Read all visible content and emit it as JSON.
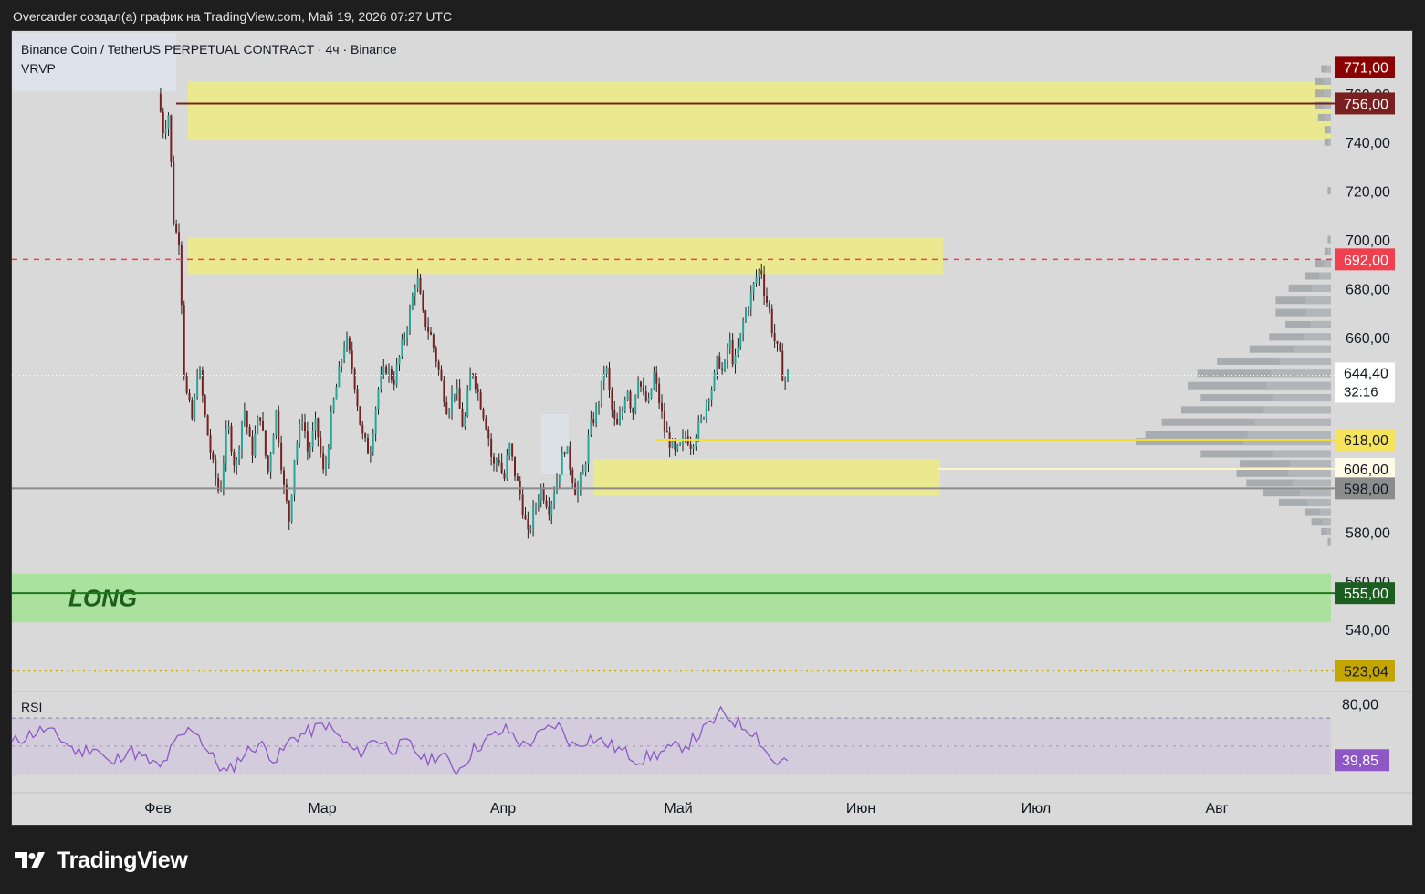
{
  "caption": "Overcarder создал(а) график на TradingView.com, Май 19, 2026 07:27 UTC",
  "brand": {
    "name": "TradingView",
    "logo_icon": "tradingview-logo-icon"
  },
  "legend": {
    "symbol_line": "Binance Coin / TetherUS PERPETUAL CONTRACT · 4ч · Binance",
    "indicator": "VRVP"
  },
  "colors": {
    "page_bg": "#1e1e1e",
    "chart_bg": "#d9d9d9",
    "candle_up": "#26a69a",
    "candle_down": "#7a1f1f",
    "resistance_zone": "#ecea8c",
    "long_zone": "#a8e29a",
    "long_text": "#1b5e20",
    "red_dashed": "#f0404f",
    "rsi_line": "#8f57c6",
    "rsi_band": "#cfc8dc",
    "volume_profile": "#9fa3a8"
  },
  "chart_data": {
    "type": "candlestick",
    "symbol": "Binance Coin / TetherUS PERPETUAL CONTRACT",
    "timeframe": "4ч",
    "exchange": "Binance",
    "x_ticks": [
      "Фев",
      "Мар",
      "Апр",
      "Май",
      "Июн",
      "Июл",
      "Авг"
    ],
    "y_ticks": [
      540,
      560,
      580,
      600,
      620,
      640,
      660,
      680,
      700,
      720,
      740,
      760
    ],
    "ylim": [
      515,
      785
    ],
    "scale": "linear",
    "grid": false,
    "price_path": [
      [
        0.0,
        760
      ],
      [
        0.004,
        745
      ],
      [
        0.008,
        752
      ],
      [
        0.012,
        705
      ],
      [
        0.016,
        700
      ],
      [
        0.02,
        640
      ],
      [
        0.026,
        625
      ],
      [
        0.03,
        650
      ],
      [
        0.035,
        628
      ],
      [
        0.04,
        610
      ],
      [
        0.046,
        595
      ],
      [
        0.052,
        625
      ],
      [
        0.058,
        605
      ],
      [
        0.064,
        632
      ],
      [
        0.07,
        612
      ],
      [
        0.076,
        630
      ],
      [
        0.082,
        604
      ],
      [
        0.088,
        630
      ],
      [
        0.094,
        598
      ],
      [
        0.098,
        585
      ],
      [
        0.102,
        612
      ],
      [
        0.108,
        628
      ],
      [
        0.112,
        612
      ],
      [
        0.118,
        625
      ],
      [
        0.124,
        602
      ],
      [
        0.13,
        630
      ],
      [
        0.136,
        648
      ],
      [
        0.14,
        660
      ],
      [
        0.146,
        645
      ],
      [
        0.152,
        620
      ],
      [
        0.158,
        612
      ],
      [
        0.164,
        638
      ],
      [
        0.17,
        648
      ],
      [
        0.176,
        642
      ],
      [
        0.182,
        656
      ],
      [
        0.188,
        670
      ],
      [
        0.193,
        686
      ],
      [
        0.198,
        668
      ],
      [
        0.204,
        660
      ],
      [
        0.21,
        645
      ],
      [
        0.216,
        630
      ],
      [
        0.222,
        640
      ],
      [
        0.228,
        622
      ],
      [
        0.234,
        648
      ],
      [
        0.24,
        635
      ],
      [
        0.246,
        622
      ],
      [
        0.25,
        606
      ],
      [
        0.254,
        612
      ],
      [
        0.258,
        600
      ],
      [
        0.262,
        616
      ],
      [
        0.266,
        605
      ],
      [
        0.27,
        596
      ],
      [
        0.273,
        588
      ],
      [
        0.276,
        578
      ],
      [
        0.28,
        588
      ],
      [
        0.286,
        598
      ],
      [
        0.292,
        590
      ],
      [
        0.298,
        602
      ],
      [
        0.304,
        616
      ],
      [
        0.308,
        606
      ],
      [
        0.312,
        596
      ],
      [
        0.318,
        605
      ],
      [
        0.322,
        622
      ],
      [
        0.326,
        628
      ],
      [
        0.33,
        636
      ],
      [
        0.334,
        650
      ],
      [
        0.338,
        632
      ],
      [
        0.342,
        622
      ],
      [
        0.346,
        628
      ],
      [
        0.35,
        641
      ],
      [
        0.354,
        628
      ],
      [
        0.358,
        645
      ],
      [
        0.362,
        636
      ],
      [
        0.366,
        632
      ],
      [
        0.37,
        645
      ],
      [
        0.374,
        634
      ],
      [
        0.378,
        622
      ],
      [
        0.382,
        617
      ],
      [
        0.386,
        612
      ],
      [
        0.39,
        615
      ],
      [
        0.394,
        620
      ],
      [
        0.398,
        616
      ],
      [
        0.402,
        622
      ],
      [
        0.406,
        626
      ],
      [
        0.41,
        636
      ],
      [
        0.414,
        640
      ],
      [
        0.418,
        652
      ],
      [
        0.422,
        644
      ],
      [
        0.426,
        660
      ],
      [
        0.43,
        648
      ],
      [
        0.434,
        658
      ],
      [
        0.438,
        670
      ],
      [
        0.442,
        676
      ],
      [
        0.446,
        684
      ],
      [
        0.45,
        689
      ],
      [
        0.453,
        677
      ],
      [
        0.456,
        672
      ],
      [
        0.459,
        661
      ],
      [
        0.462,
        655
      ],
      [
        0.464,
        652
      ],
      [
        0.466,
        645
      ],
      [
        0.468,
        643
      ],
      [
        0.47,
        645
      ]
    ],
    "zones": [
      {
        "name": "resistance-zone-top",
        "from": 741,
        "to": 765
      },
      {
        "name": "resistance-zone-mid",
        "from": 686,
        "to": 701
      },
      {
        "name": "demand-zone",
        "from": 595,
        "to": 610
      },
      {
        "name": "long-zone",
        "label": "LONG",
        "from": 543,
        "to": 563
      }
    ],
    "levels": [
      {
        "name": "level-756",
        "price": 756.0,
        "label": "756,00",
        "style": "solid",
        "color": "#7a1f1f",
        "tag_bg": "#7a1f1f",
        "tag_fg": "#ffffff"
      },
      {
        "name": "level-771",
        "price": 771.0,
        "label": "771,00",
        "style": "none",
        "color": "#8b0000",
        "tag_bg": "#8b0000",
        "tag_fg": "#ffffff"
      },
      {
        "name": "level-692",
        "price": 692.0,
        "label": "692,00",
        "style": "dashed",
        "color": "#f0404f",
        "tag_bg": "#f0404f",
        "tag_fg": "#ffffff"
      },
      {
        "name": "level-618",
        "price": 618.0,
        "label": "618,00",
        "style": "solid",
        "color": "#f0dc3a",
        "tag_bg": "#f5e45b",
        "tag_fg": "#131722"
      },
      {
        "name": "level-606",
        "price": 606.0,
        "label": "606,00",
        "style": "solid",
        "color": "#fff5c4",
        "tag_bg": "#fffbe6",
        "tag_fg": "#131722"
      },
      {
        "name": "level-598",
        "price": 598.0,
        "label": "598,00",
        "style": "solid",
        "color": "#8c8c8c",
        "tag_bg": "#8c8c8c",
        "tag_fg": "#131722"
      },
      {
        "name": "level-555",
        "price": 555.0,
        "label": "555,00",
        "style": "solid",
        "color": "#1f7a1f",
        "tag_bg": "#1b5e20",
        "tag_fg": "#ffffff"
      },
      {
        "name": "level-523",
        "price": 523.04,
        "label": "523,04",
        "style": "dotted",
        "color": "#c9a800",
        "tag_bg": "#c2a500",
        "tag_fg": "#131722"
      }
    ],
    "last_price": {
      "value": 644.4,
      "label": "644,40",
      "countdown": "32:16"
    },
    "volume_profile": {
      "note": "relative volume by price bucket (0-1)",
      "buckets": [
        [
          770,
          0.03
        ],
        [
          765,
          0.05
        ],
        [
          760,
          0.05
        ],
        [
          755,
          0.05
        ],
        [
          750,
          0.04
        ],
        [
          745,
          0.02
        ],
        [
          740,
          0.02
        ],
        [
          720,
          0.01
        ],
        [
          700,
          0.01
        ],
        [
          695,
          0.02
        ],
        [
          690,
          0.05
        ],
        [
          685,
          0.08
        ],
        [
          680,
          0.13
        ],
        [
          675,
          0.17
        ],
        [
          670,
          0.17
        ],
        [
          665,
          0.14
        ],
        [
          660,
          0.19
        ],
        [
          655,
          0.25
        ],
        [
          650,
          0.35
        ],
        [
          645,
          0.41
        ],
        [
          640,
          0.44
        ],
        [
          635,
          0.4
        ],
        [
          630,
          0.46
        ],
        [
          625,
          0.52
        ],
        [
          620,
          0.57
        ],
        [
          617,
          0.6
        ],
        [
          612,
          0.4
        ],
        [
          608,
          0.28
        ],
        [
          604,
          0.29
        ],
        [
          600,
          0.26
        ],
        [
          596,
          0.21
        ],
        [
          592,
          0.16
        ],
        [
          588,
          0.08
        ],
        [
          584,
          0.06
        ],
        [
          580,
          0.03
        ],
        [
          576,
          0.01
        ]
      ]
    },
    "rsi": {
      "label": "RSI",
      "value": "39,85",
      "ylim": [
        20,
        85
      ],
      "upper_band": 70,
      "lower_band": 30,
      "tick": "80,00",
      "tick_value": 80,
      "series": [
        [
          0.0,
          52
        ],
        [
          0.01,
          58
        ],
        [
          0.02,
          62
        ],
        [
          0.03,
          55
        ],
        [
          0.04,
          45
        ],
        [
          0.05,
          50
        ],
        [
          0.06,
          36
        ],
        [
          0.07,
          48
        ],
        [
          0.08,
          41
        ],
        [
          0.09,
          34
        ],
        [
          0.1,
          54
        ],
        [
          0.11,
          64
        ],
        [
          0.12,
          44
        ],
        [
          0.13,
          30
        ],
        [
          0.14,
          44
        ],
        [
          0.15,
          52
        ],
        [
          0.16,
          40
        ],
        [
          0.17,
          56
        ],
        [
          0.18,
          60
        ],
        [
          0.19,
          66
        ],
        [
          0.2,
          54
        ],
        [
          0.21,
          44
        ],
        [
          0.22,
          56
        ],
        [
          0.23,
          48
        ],
        [
          0.24,
          52
        ],
        [
          0.25,
          40
        ],
        [
          0.26,
          44
        ],
        [
          0.27,
          32
        ],
        [
          0.28,
          48
        ],
        [
          0.29,
          56
        ],
        [
          0.3,
          62
        ],
        [
          0.31,
          50
        ],
        [
          0.32,
          58
        ],
        [
          0.33,
          66
        ],
        [
          0.34,
          50
        ],
        [
          0.35,
          56
        ],
        [
          0.36,
          52
        ],
        [
          0.37,
          46
        ],
        [
          0.38,
          40
        ],
        [
          0.39,
          44
        ],
        [
          0.4,
          48
        ],
        [
          0.41,
          52
        ],
        [
          0.42,
          62
        ],
        [
          0.43,
          74
        ],
        [
          0.44,
          66
        ],
        [
          0.45,
          60
        ],
        [
          0.455,
          50
        ],
        [
          0.46,
          40
        ],
        [
          0.465,
          38
        ],
        [
          0.47,
          40
        ]
      ]
    }
  }
}
